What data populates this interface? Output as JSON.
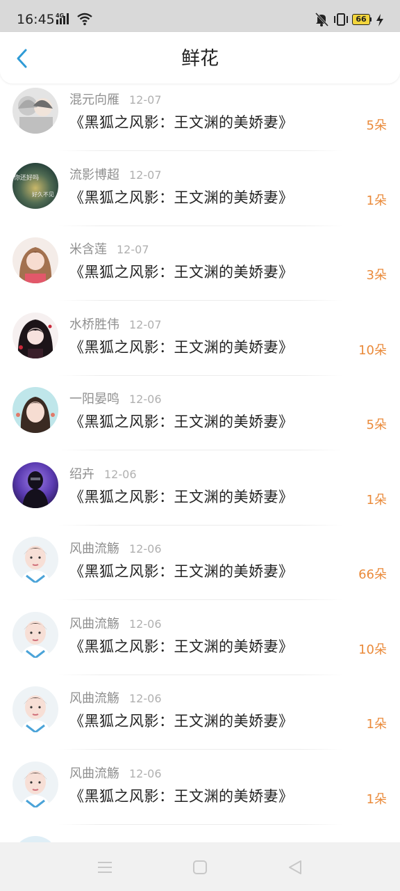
{
  "status_bar": {
    "time": "16:45",
    "network": "4G",
    "battery_level": "66",
    "icons": [
      "signal-icon",
      "wifi-icon",
      "mute-icon",
      "vibrate-icon",
      "battery-icon",
      "charging-icon"
    ]
  },
  "header": {
    "title": "鲜花",
    "back_icon": "chevron-left-icon",
    "accent_color": "#2f9bd6"
  },
  "colors": {
    "count": "#ea8a3a",
    "username": "#8f8f8f",
    "date": "#b0b0b0",
    "title": "#222222"
  },
  "gifts": [
    {
      "user": "混元向雁",
      "date": "12-07",
      "title": "《黑狐之风影：王文渊的美娇妻》",
      "count": "5朵"
    },
    {
      "user": "流影博超",
      "date": "12-07",
      "title": "《黑狐之风影：王文渊的美娇妻》",
      "count": "1朵",
      "avatar_text": [
        "你还好吗",
        "好久不见"
      ]
    },
    {
      "user": "米含莲",
      "date": "12-07",
      "title": "《黑狐之风影：王文渊的美娇妻》",
      "count": "3朵"
    },
    {
      "user": "水桥胜伟",
      "date": "12-07",
      "title": "《黑狐之风影：王文渊的美娇妻》",
      "count": "10朵"
    },
    {
      "user": "一阳晏鸣",
      "date": "12-06",
      "title": "《黑狐之风影：王文渊的美娇妻》",
      "count": "5朵"
    },
    {
      "user": "绍卉",
      "date": "12-06",
      "title": "《黑狐之风影：王文渊的美娇妻》",
      "count": "1朵"
    },
    {
      "user": "风曲流觞",
      "date": "12-06",
      "title": "《黑狐之风影：王文渊的美娇妻》",
      "count": "66朵"
    },
    {
      "user": "风曲流觞",
      "date": "12-06",
      "title": "《黑狐之风影：王文渊的美娇妻》",
      "count": "10朵"
    },
    {
      "user": "风曲流觞",
      "date": "12-06",
      "title": "《黑狐之风影：王文渊的美娇妻》",
      "count": "1朵"
    },
    {
      "user": "风曲流觞",
      "date": "12-06",
      "title": "《黑狐之风影：王文渊的美娇妻》",
      "count": "1朵"
    }
  ],
  "nav_bar": {
    "buttons": [
      "menu-icon",
      "home-icon",
      "back-icon"
    ]
  }
}
